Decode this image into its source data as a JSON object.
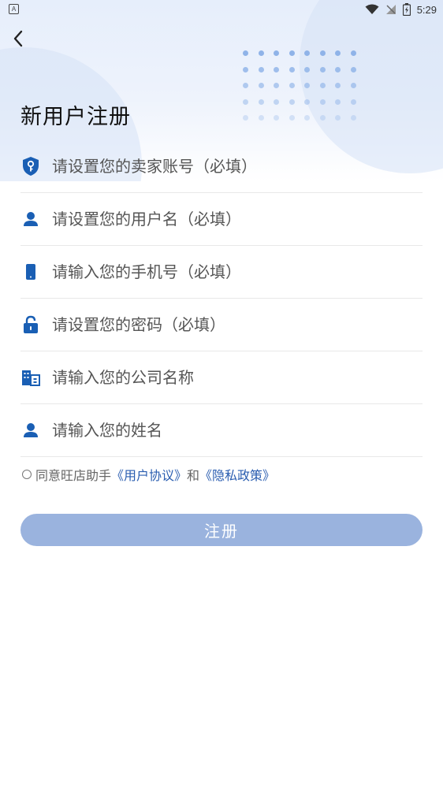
{
  "status_bar": {
    "left_indicator": "A",
    "time": "5:29",
    "icons": [
      "wifi-icon",
      "no-signal-icon",
      "battery-icon"
    ]
  },
  "header": {
    "back_icon": "chevron-left-icon",
    "title": "新用户注册"
  },
  "form": {
    "fields": [
      {
        "icon": "shield-key-icon",
        "placeholder": "请设置您的卖家账号（必填）",
        "value": ""
      },
      {
        "icon": "user-icon",
        "placeholder": "请设置您的用户名（必填）",
        "value": ""
      },
      {
        "icon": "phone-icon",
        "placeholder": "请输入您的手机号（必填）",
        "value": ""
      },
      {
        "icon": "lock-icon",
        "placeholder": "请设置您的密码（必填）",
        "value": ""
      },
      {
        "icon": "building-icon",
        "placeholder": "请输入您的公司名称",
        "value": ""
      },
      {
        "icon": "user-icon",
        "placeholder": "请输入您的姓名",
        "value": ""
      }
    ]
  },
  "agreement": {
    "prefix": "同意旺店助手",
    "user_agreement": "《用户协议》",
    "conjunction": "和",
    "privacy_policy": "《隐私政策》",
    "checked": false
  },
  "register_button": {
    "label": "注册",
    "enabled": false
  },
  "colors": {
    "accent": "#1a5fb4",
    "link": "#2a5db0",
    "button_disabled": "#9ab3de"
  }
}
